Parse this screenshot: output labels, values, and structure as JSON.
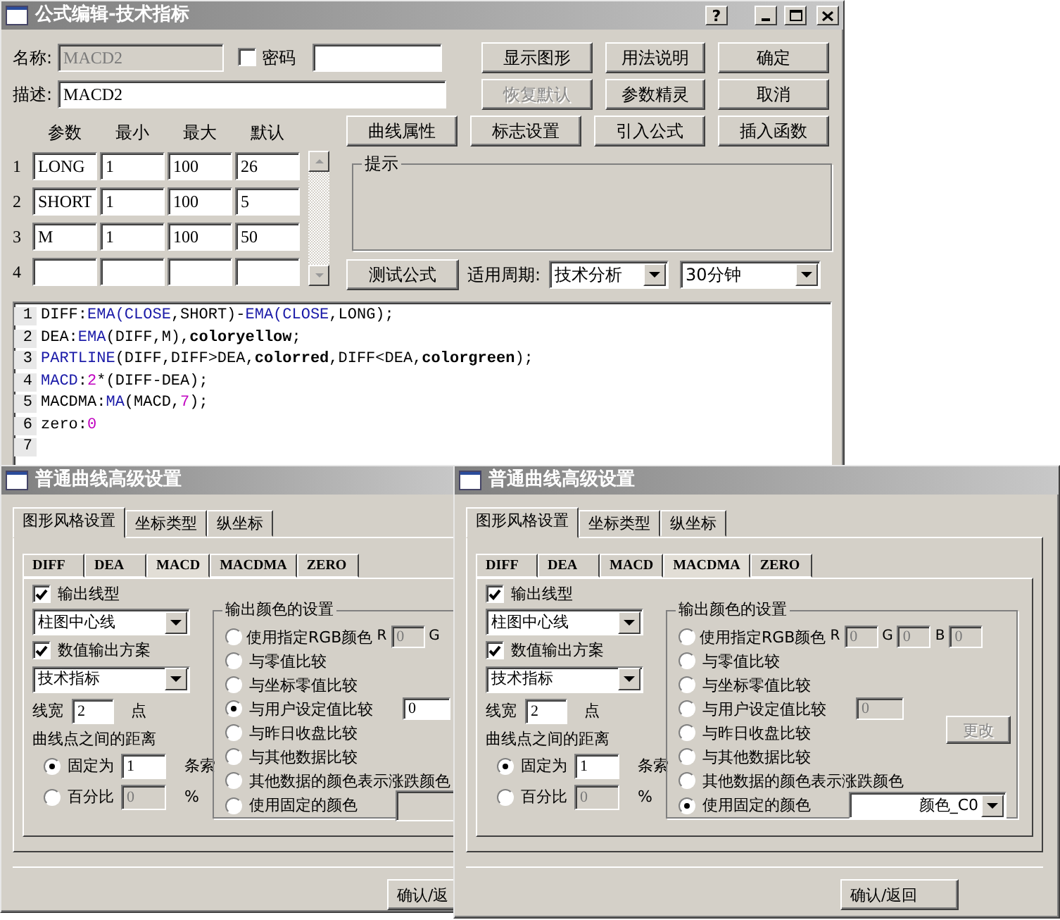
{
  "main_window": {
    "title": "公式编辑-技术指标",
    "help_button": "?",
    "name_label": "名称:",
    "name_field": {
      "value": "MACD2",
      "disabled": true
    },
    "password": {
      "label": "密码",
      "checked": false
    },
    "description_label": "描述:",
    "description_value": "MACD2",
    "buttons": [
      {
        "label": "显示图形",
        "disabled": false
      },
      {
        "label": "用法说明",
        "disabled": false
      },
      {
        "label": "确定",
        "disabled": false
      },
      {
        "label": "恢复默认",
        "disabled": true
      },
      {
        "label": "参数精灵",
        "disabled": false
      },
      {
        "label": "取消",
        "disabled": false
      }
    ],
    "param_columns": [
      "参数",
      "最小",
      "最大",
      "默认"
    ],
    "params": [
      {
        "index": "1",
        "values": [
          "LONG",
          "1",
          "100",
          "26"
        ]
      },
      {
        "index": "2",
        "values": [
          "SHORT",
          "1",
          "100",
          "5"
        ]
      },
      {
        "index": "3",
        "values": [
          "M",
          "1",
          "100",
          "50"
        ]
      },
      {
        "index": "4"
      }
    ],
    "tool_buttons": [
      "曲线属性",
      "标志设置",
      "引入公式",
      "插入函数"
    ],
    "hint": {
      "title": "提示"
    },
    "test_button": "测试公式",
    "period_label": "适用周期:",
    "selects": [
      "技术分析",
      "30分钟"
    ],
    "code_lines": [
      {
        "number": "1",
        "tokens": [
          {
            "kind": "plain",
            "text": "DIFF:"
          },
          {
            "kind": "func",
            "text": "EMA(CLOSE"
          },
          {
            "kind": "plain",
            "text": ",SHORT)-"
          },
          {
            "kind": "func",
            "text": "EMA(CLOSE"
          },
          {
            "kind": "plain",
            "text": ",LONG);"
          }
        ]
      },
      {
        "number": "2",
        "tokens": [
          {
            "kind": "plain",
            "text": "DEA:"
          },
          {
            "kind": "func",
            "text": "EMA"
          },
          {
            "kind": "plain",
            "text": "(DIFF,M),"
          },
          {
            "kind": "color",
            "text": "coloryellow"
          },
          {
            "kind": "plain",
            "text": ";"
          }
        ]
      },
      {
        "number": "3",
        "tokens": [
          {
            "kind": "func",
            "text": "PARTLINE"
          },
          {
            "kind": "plain",
            "text": "(DIFF,DIFF>DEA,"
          },
          {
            "kind": "color",
            "text": "colorred"
          },
          {
            "kind": "plain",
            "text": ",DIFF<DEA,"
          },
          {
            "kind": "color",
            "text": "colorgreen"
          },
          {
            "kind": "plain",
            "text": ");"
          }
        ]
      },
      {
        "number": "4",
        "tokens": [
          {
            "kind": "func",
            "text": "MACD"
          },
          {
            "kind": "plain",
            "text": ":"
          },
          {
            "kind": "number",
            "text": "2"
          },
          {
            "kind": "plain",
            "text": "*(DIFF-DEA);"
          }
        ]
      },
      {
        "number": "5",
        "tokens": [
          {
            "kind": "plain",
            "text": "MACDMA:"
          },
          {
            "kind": "func",
            "text": "MA"
          },
          {
            "kind": "plain",
            "text": "(MACD,"
          },
          {
            "kind": "number",
            "text": "7"
          },
          {
            "kind": "plain",
            "text": ");"
          }
        ]
      },
      {
        "number": "6",
        "tokens": [
          {
            "kind": "plain",
            "text": "zero:"
          },
          {
            "kind": "number",
            "text": "0"
          }
        ]
      },
      {
        "number": "7"
      }
    ]
  },
  "dialogs": [
    {
      "title": "普通曲线高级设置",
      "tabs": [
        {
          "label": "图形风格设置",
          "selected": true
        },
        {
          "label": "坐标类型",
          "selected": false
        },
        {
          "label": "纵坐标",
          "selected": false
        }
      ],
      "series_tabs": [
        {
          "label": "DIFF",
          "selected": false
        },
        {
          "label": "DEA",
          "selected": false
        },
        {
          "label": "MACD",
          "selected": true
        },
        {
          "label": "MACDMA",
          "selected": false
        },
        {
          "label": "ZERO",
          "selected": false
        }
      ],
      "line_type": {
        "label": "输出线型",
        "checked": true,
        "value": "柱图中心线"
      },
      "value_output": {
        "label": "数值输出方案",
        "checked": true,
        "value": "技术指标"
      },
      "line_width": {
        "label": "线宽",
        "value": "2",
        "unit": "点"
      },
      "spacing_label": "曲线点之间的距离",
      "spacing": [
        {
          "label": "固定为",
          "selected": true,
          "value": "1",
          "unit": "条索",
          "disabled": false
        },
        {
          "label": "百分比",
          "selected": false,
          "value": "0",
          "unit": "%",
          "disabled": true
        }
      ],
      "color_group": {
        "title": "输出颜色的设置",
        "options": [
          {
            "kind": "rgb",
            "label": "使用指定RGB颜色",
            "selected": false,
            "fields": [
              {
                "label": "R",
                "value": "0"
              },
              {
                "label": "G"
              }
            ]
          },
          {
            "kind": "plain",
            "label": "与零值比较",
            "selected": false
          },
          {
            "kind": "plain",
            "label": "与坐标零值比较",
            "selected": false
          },
          {
            "kind": "value",
            "label": "与用户设定值比较",
            "selected": true,
            "value": "0",
            "disabled": false
          },
          {
            "kind": "plain",
            "label": "与昨日收盘比较",
            "selected": false
          },
          {
            "kind": "plain",
            "label": "与其他数据比较",
            "selected": false
          },
          {
            "kind": "plain",
            "label": "其他数据的颜色表示涨跌颜色",
            "selected": false
          },
          {
            "kind": "fixed",
            "label": "使用固定的颜色",
            "selected": false
          }
        ]
      },
      "confirm_button": "确认/返"
    },
    {
      "title": "普通曲线高级设置",
      "tabs": [
        {
          "label": "图形风格设置",
          "selected": true
        },
        {
          "label": "坐标类型",
          "selected": false
        },
        {
          "label": "纵坐标",
          "selected": false
        }
      ],
      "series_tabs": [
        {
          "label": "DIFF",
          "selected": false
        },
        {
          "label": "DEA",
          "selected": false
        },
        {
          "label": "MACD",
          "selected": false
        },
        {
          "label": "MACDMA",
          "selected": true
        },
        {
          "label": "ZERO",
          "selected": false
        }
      ],
      "line_type": {
        "label": "输出线型",
        "checked": true,
        "value": "柱图中心线"
      },
      "value_output": {
        "label": "数值输出方案",
        "checked": true,
        "value": "技术指标"
      },
      "line_width": {
        "label": "线宽",
        "value": "2",
        "unit": "点"
      },
      "spacing_label": "曲线点之间的距离",
      "spacing": [
        {
          "label": "固定为",
          "selected": true,
          "value": "1",
          "unit": "条索",
          "disabled": false
        },
        {
          "label": "百分比",
          "selected": false,
          "value": "0",
          "unit": "%",
          "disabled": true
        }
      ],
      "color_group": {
        "title": "输出颜色的设置",
        "options": [
          {
            "kind": "rgb",
            "label": "使用指定RGB颜色",
            "selected": false,
            "fields": [
              {
                "label": "R",
                "value": "0"
              },
              {
                "label": "G",
                "value": "0"
              },
              {
                "label": "B",
                "value": "0"
              }
            ]
          },
          {
            "kind": "plain",
            "label": "与零值比较",
            "selected": false
          },
          {
            "kind": "plain",
            "label": "与坐标零值比较",
            "selected": false
          },
          {
            "kind": "value",
            "label": "与用户设定值比较",
            "selected": false,
            "value": "0",
            "disabled": true
          },
          {
            "kind": "plain",
            "label": "与昨日收盘比较",
            "selected": false
          },
          {
            "kind": "plain",
            "label": "与其他数据比较",
            "selected": false
          },
          {
            "kind": "plain",
            "label": "其他数据的颜色表示涨跌颜色",
            "selected": false
          },
          {
            "kind": "fixed",
            "label": "使用固定的颜色",
            "selected": true,
            "value": "颜色_C0"
          }
        ]
      },
      "change_button": {
        "label": "更改",
        "disabled": true
      },
      "confirm_button": "确认/返回"
    }
  ]
}
